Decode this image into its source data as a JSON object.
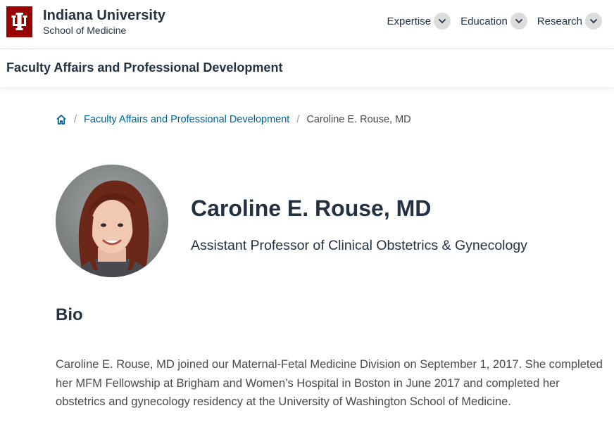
{
  "header": {
    "logo_icon": "iu-trident-icon",
    "brand_color": "#990000",
    "title": "Indiana University",
    "subtitle": "School of Medicine",
    "nav": [
      {
        "label": "Expertise",
        "icon": "chevron-down-icon"
      },
      {
        "label": "Education",
        "icon": "chevron-down-icon"
      },
      {
        "label": "Research",
        "icon": "chevron-down-icon"
      }
    ]
  },
  "site": {
    "title": "Faculty Affairs and Professional Development"
  },
  "breadcrumb": {
    "home_icon": "home-icon",
    "link_color": "#006298",
    "separator": "/",
    "items": [
      "Faculty Affairs and Professional Development",
      "Caroline E. Rouse, MD"
    ]
  },
  "profile": {
    "name": "Caroline E. Rouse, MD",
    "title": "Assistant Professor of Clinical Obstetrics & Gynecology"
  },
  "bio": {
    "heading": "Bio",
    "text": "Caroline E. Rouse, MD joined our Maternal-Fetal Medicine Division on September 1, 2017. She completed her MFM Fellowship at Brigham and Women’s Hospital in Boston in June 2017 and completed her obstetrics and gynecology residency at the University of Washington School of Medicine."
  }
}
